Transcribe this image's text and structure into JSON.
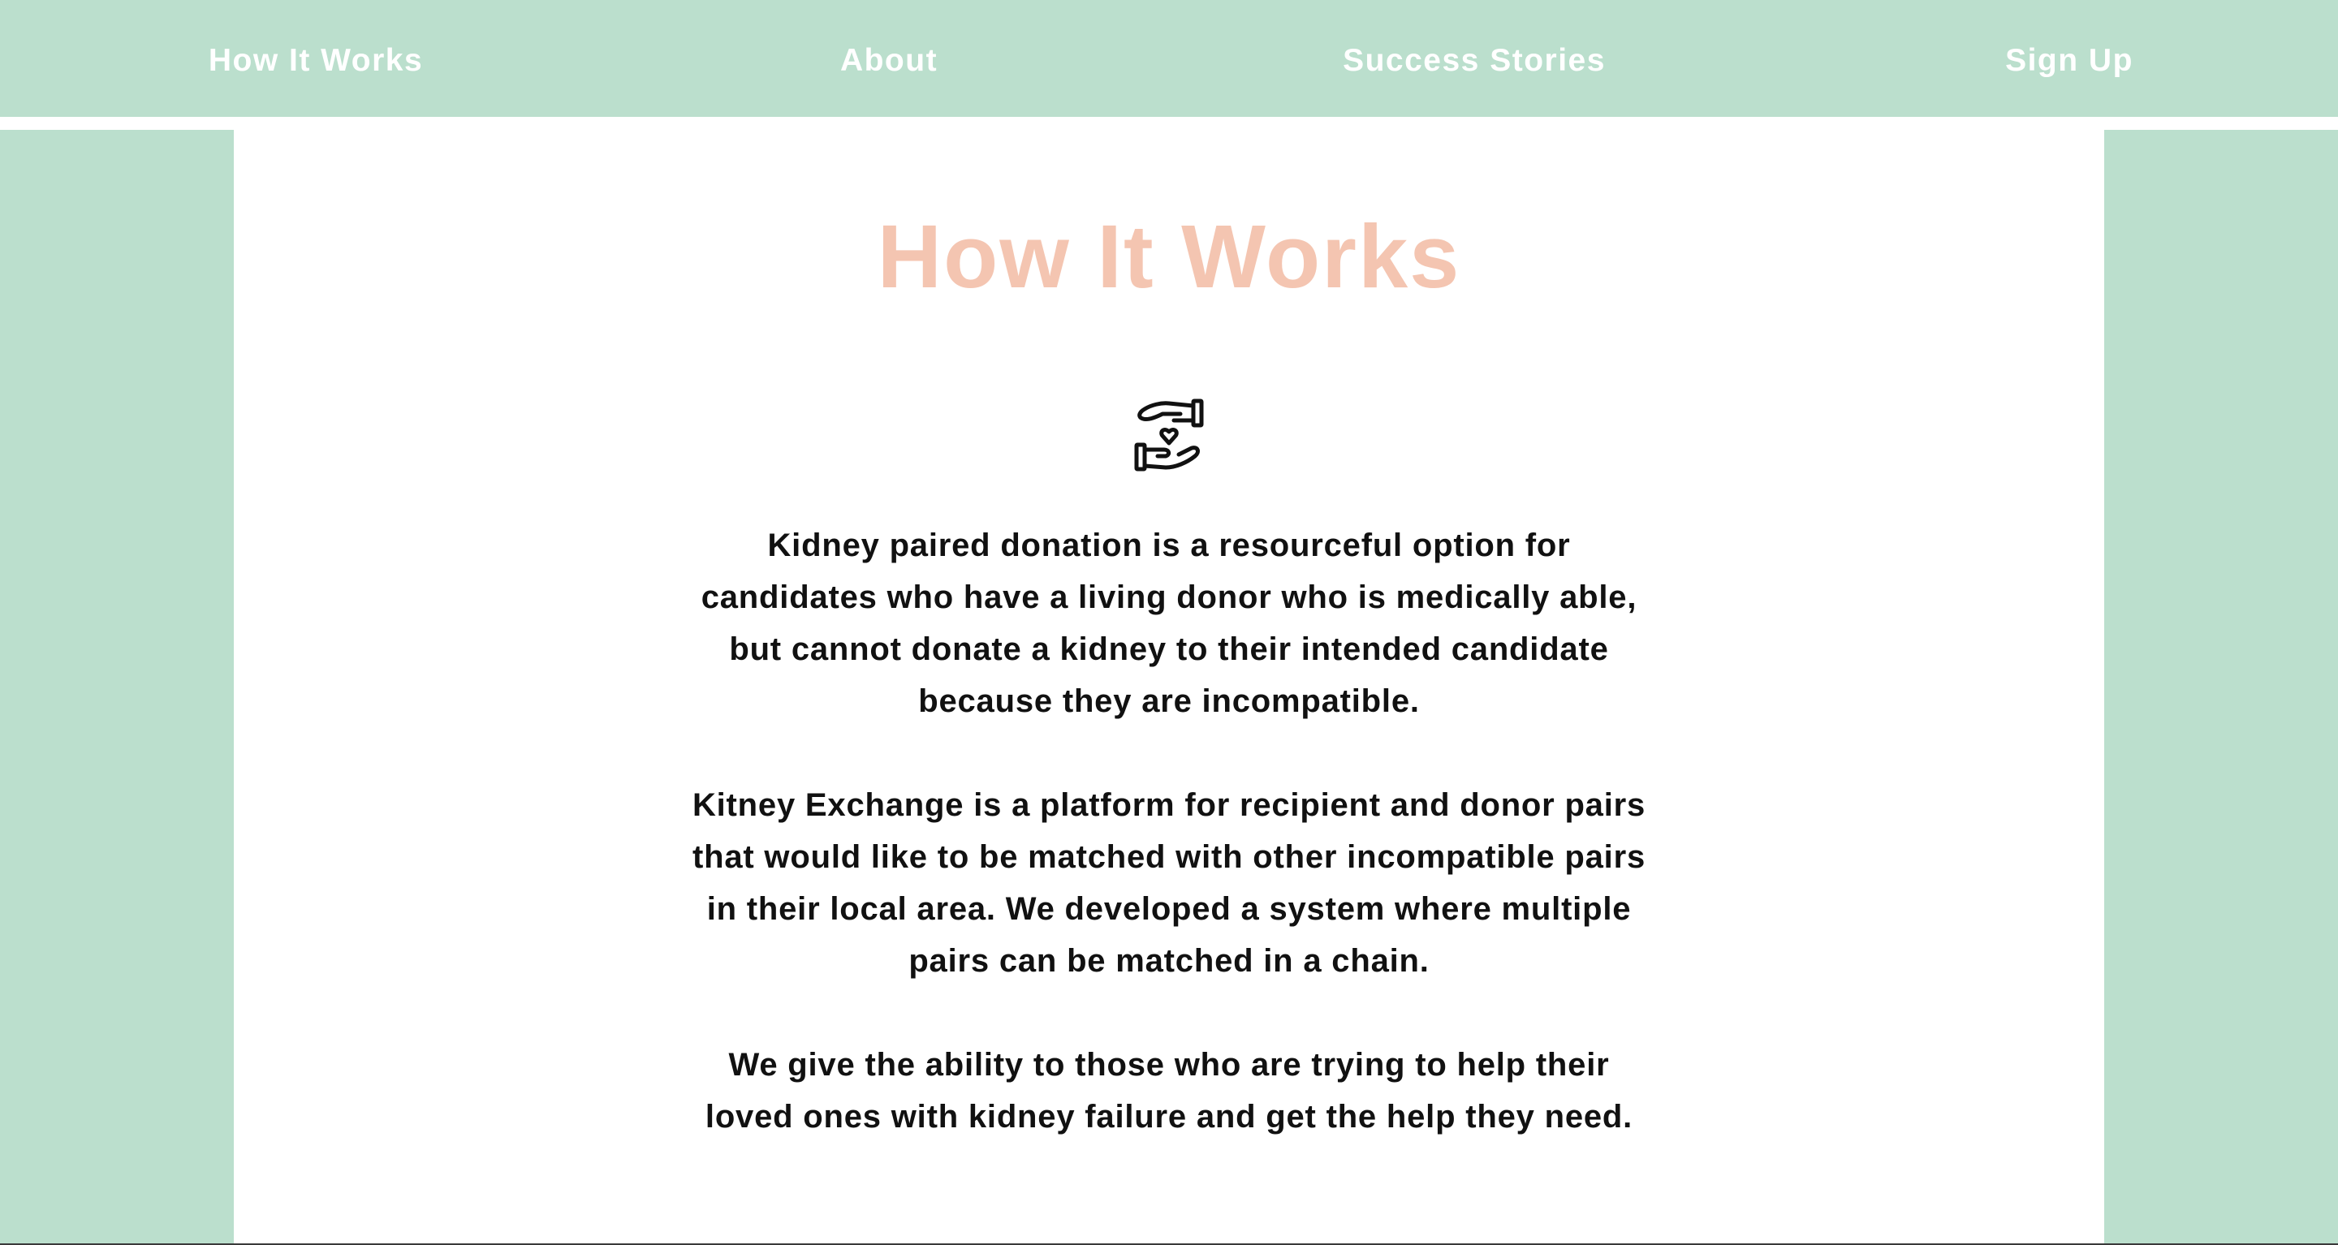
{
  "nav": {
    "items": [
      {
        "label": "How It Works"
      },
      {
        "label": "About"
      },
      {
        "label": "Success Stories"
      },
      {
        "label": "Sign Up"
      }
    ]
  },
  "main": {
    "title": "How It Works",
    "icon": "hands-heart-icon",
    "paragraphs": [
      "Kidney paired donation is a resourceful option for candidates who have a living donor who is medically able, but cannot donate a kidney to their intended candidate because they are incompatible.",
      "Kitney Exchange is a platform for recipient and donor pairs that would like to be matched with other incompatible pairs in their local area. We developed a system where multiple pairs can be matched in a chain.",
      "We give the ability to those who are trying to help their loved ones with kidney failure and get the help they need."
    ]
  },
  "colors": {
    "background": "#bbdfcd",
    "title": "#f4c5b1",
    "nav_text": "#ffffff",
    "body_text": "#111111",
    "panel": "#ffffff"
  }
}
